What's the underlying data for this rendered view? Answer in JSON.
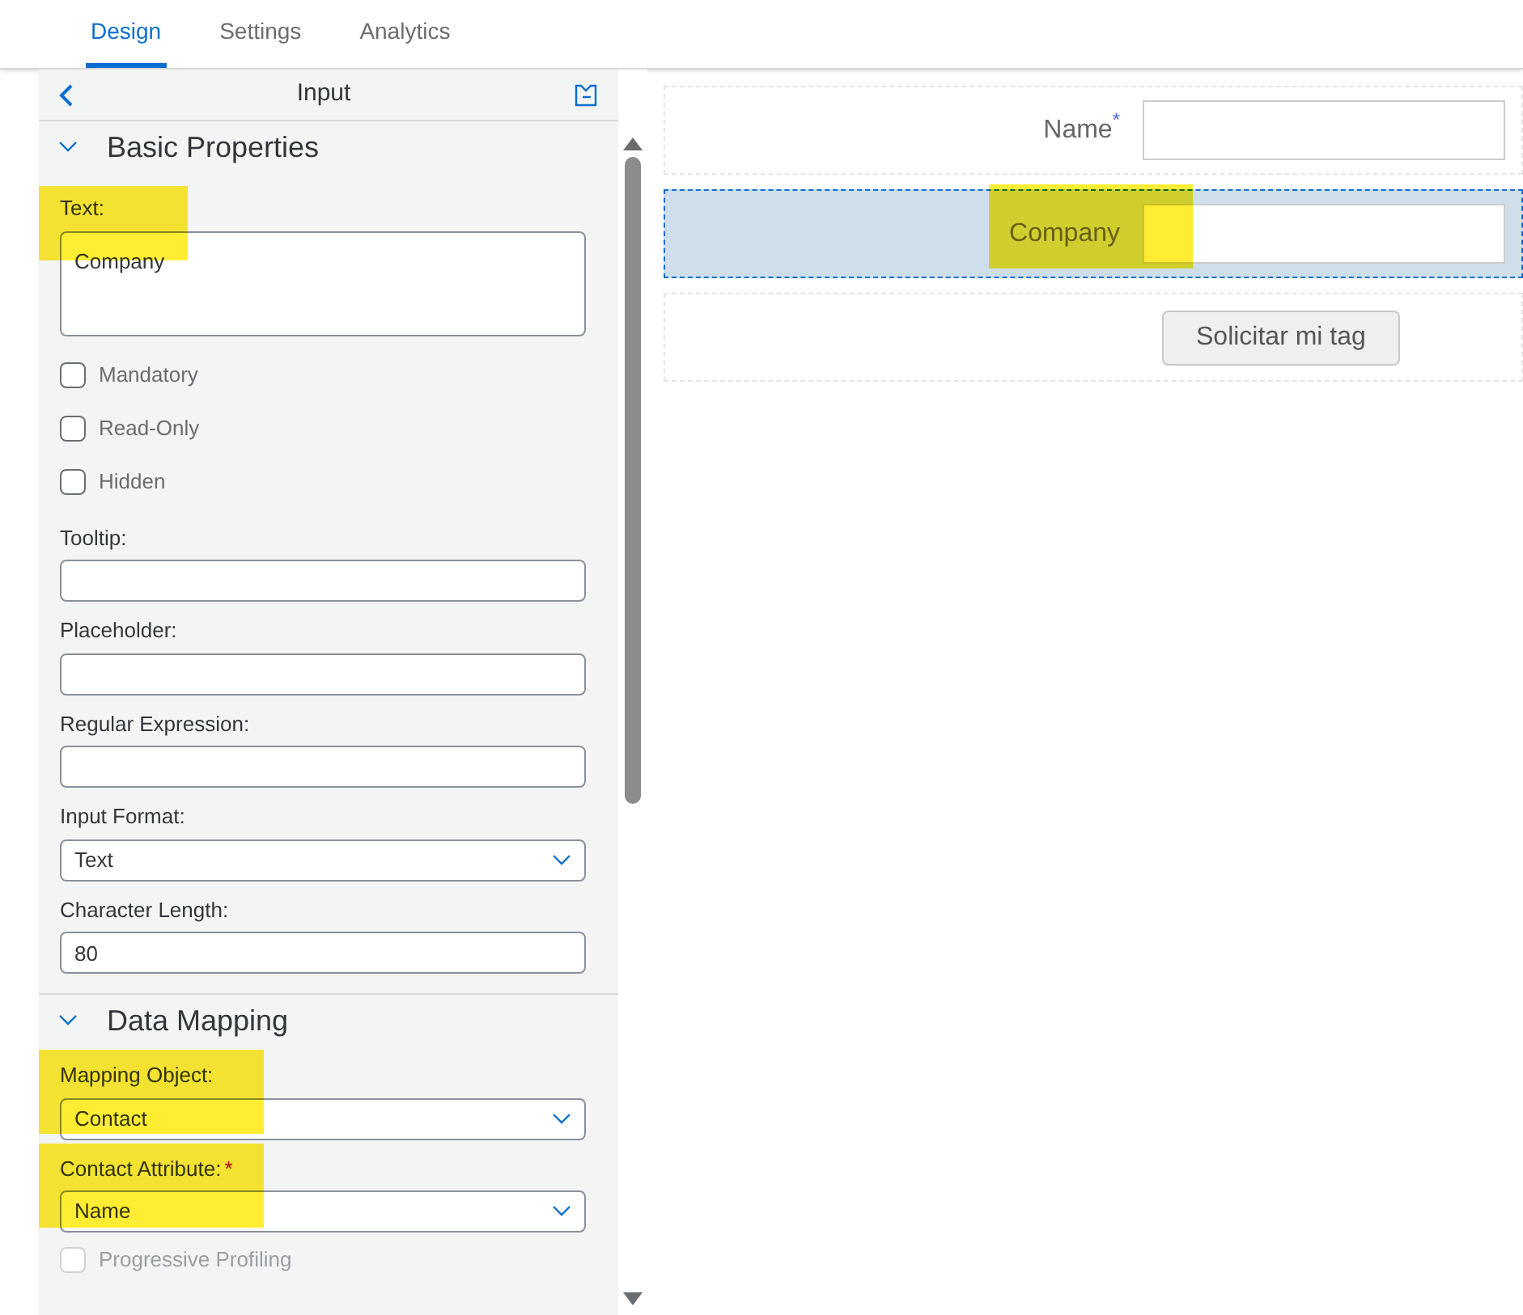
{
  "tabs": [
    {
      "label": "Design",
      "selected": true
    },
    {
      "label": "Settings",
      "selected": false
    },
    {
      "label": "Analytics",
      "selected": false
    }
  ],
  "panel": {
    "title": "Input",
    "sections": [
      {
        "title": "Basic Properties",
        "expanded": true,
        "fields": [
          {
            "kind": "textarea",
            "label": "Text:",
            "value": "Company",
            "highlighted": true
          },
          {
            "kind": "checkbox",
            "label": "Mandatory",
            "checked": false,
            "disabled": false
          },
          {
            "kind": "checkbox",
            "label": "Read-Only",
            "checked": false,
            "disabled": false
          },
          {
            "kind": "checkbox",
            "label": "Hidden",
            "checked": false,
            "disabled": false
          },
          {
            "kind": "text",
            "label": "Tooltip:"
          },
          {
            "kind": "text",
            "label": "Placeholder:"
          },
          {
            "kind": "text",
            "label": "Regular Expression:"
          },
          {
            "kind": "select",
            "label": "Input Format:",
            "value": "Text"
          },
          {
            "kind": "text",
            "label": "Character Length:",
            "value": "80"
          }
        ]
      },
      {
        "title": "Data Mapping",
        "expanded": true,
        "fields": [
          {
            "kind": "select",
            "label": "Mapping Object:",
            "value": "Contact",
            "highlighted": true
          },
          {
            "kind": "select",
            "label": "Contact Attribute:",
            "required_mark": "*",
            "value": "Name",
            "highlighted": true
          },
          {
            "kind": "checkbox",
            "label": "Progressive Profiling",
            "checked": false,
            "disabled": true
          }
        ]
      }
    ]
  },
  "preview": {
    "rows": [
      {
        "kind": "input",
        "label": "Name",
        "required_mark": "*",
        "selected": false,
        "highlighted": false
      },
      {
        "kind": "input",
        "label": "Company",
        "selected": true,
        "highlighted": true
      },
      {
        "kind": "button",
        "label": "Solicitar mi tag",
        "selected": false
      }
    ]
  }
}
